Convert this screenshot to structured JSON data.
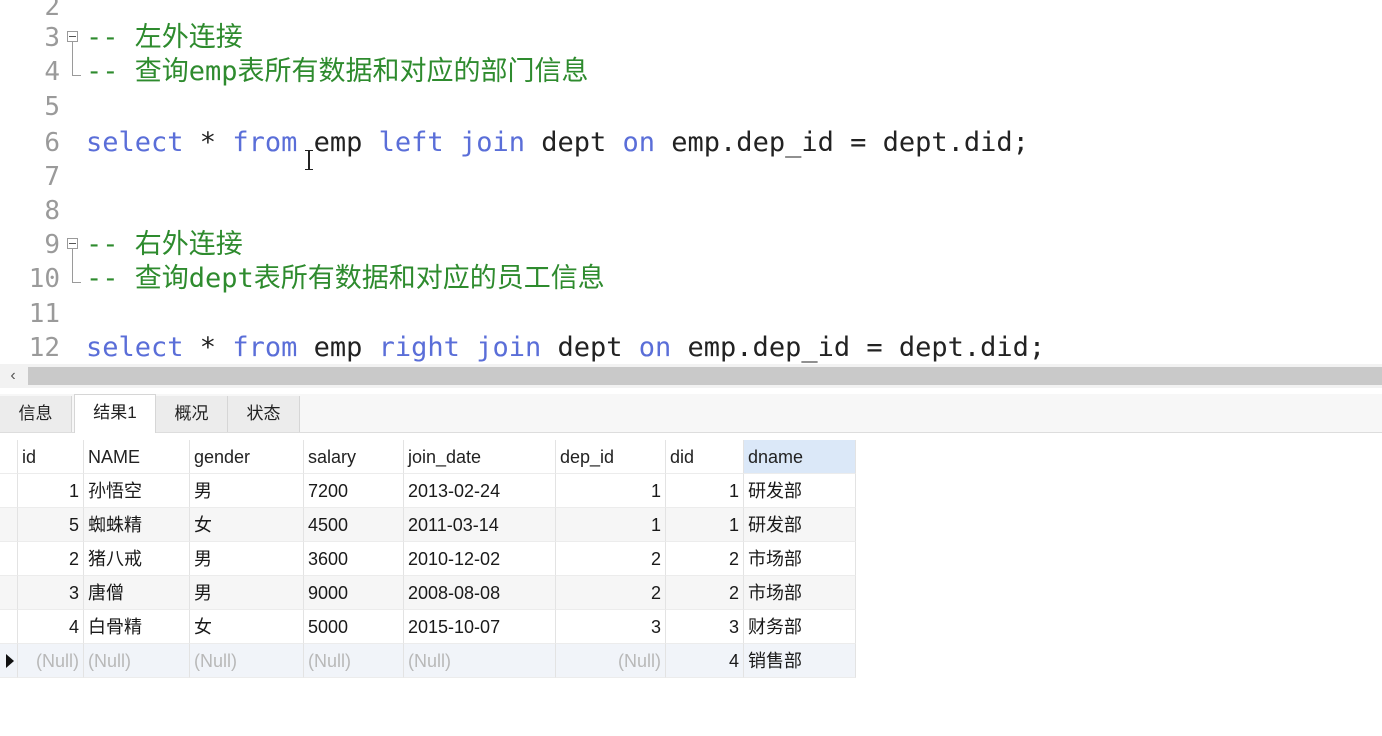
{
  "editor": {
    "lines": [
      {
        "num": "2",
        "segments": []
      },
      {
        "num": "3",
        "fold": "start",
        "segments": [
          {
            "t": "-- 左外连接",
            "c": "cmt"
          }
        ]
      },
      {
        "num": "4",
        "fold": "end",
        "segments": [
          {
            "t": "-- 查询emp表所有数据和对应的部门信息",
            "c": "cmt"
          }
        ]
      },
      {
        "num": "5",
        "segments": []
      },
      {
        "num": "6",
        "segments": [
          {
            "t": "select",
            "c": "kw"
          },
          {
            "t": " * ",
            "c": "pl"
          },
          {
            "t": "from",
            "c": "kw"
          },
          {
            "t": " emp ",
            "c": "pl"
          },
          {
            "t": "left",
            "c": "kw"
          },
          {
            "t": " ",
            "c": "pl"
          },
          {
            "t": "join",
            "c": "kw"
          },
          {
            "t": " dept ",
            "c": "pl"
          },
          {
            "t": "on",
            "c": "kw"
          },
          {
            "t": " emp.dep_id = dept.did;",
            "c": "pl"
          }
        ]
      },
      {
        "num": "7",
        "segments": []
      },
      {
        "num": "8",
        "segments": []
      },
      {
        "num": "9",
        "fold": "start",
        "segments": [
          {
            "t": "-- 右外连接",
            "c": "cmt"
          }
        ]
      },
      {
        "num": "10",
        "fold": "end",
        "segments": [
          {
            "t": "-- 查询dept表所有数据和对应的员工信息",
            "c": "cmt"
          }
        ]
      },
      {
        "num": "11",
        "segments": []
      },
      {
        "num": "12",
        "segments": [
          {
            "t": "select",
            "c": "kw"
          },
          {
            "t": " * ",
            "c": "pl"
          },
          {
            "t": "from",
            "c": "kw"
          },
          {
            "t": " emp ",
            "c": "pl"
          },
          {
            "t": "right",
            "c": "kw"
          },
          {
            "t": " ",
            "c": "pl"
          },
          {
            "t": "join",
            "c": "kw"
          },
          {
            "t": " dept ",
            "c": "pl"
          },
          {
            "t": "on",
            "c": "kw"
          },
          {
            "t": " emp.dep_id = dept.did;",
            "c": "pl"
          }
        ]
      }
    ]
  },
  "scrollbar": {
    "left_arrow": "‹"
  },
  "tabs": [
    {
      "label": "信息",
      "active": false
    },
    {
      "label": "结果1",
      "active": true
    },
    {
      "label": "概况",
      "active": false
    },
    {
      "label": "状态",
      "active": false
    }
  ],
  "grid": {
    "columns": [
      "id",
      "NAME",
      "gender",
      "salary",
      "join_date",
      "dep_id",
      "did",
      "dname"
    ],
    "rows": [
      [
        "1",
        "孙悟空",
        "男",
        "7200",
        "2013-02-24",
        "1",
        "1",
        "研发部"
      ],
      [
        "5",
        "蜘蛛精",
        "女",
        "4500",
        "2011-03-14",
        "1",
        "1",
        "研发部"
      ],
      [
        "2",
        "猪八戒",
        "男",
        "3600",
        "2010-12-02",
        "2",
        "2",
        "市场部"
      ],
      [
        "3",
        "唐僧",
        "男",
        "9000",
        "2008-08-08",
        "2",
        "2",
        "市场部"
      ],
      [
        "4",
        "白骨精",
        "女",
        "5000",
        "2015-10-07",
        "3",
        "3",
        "财务部"
      ],
      [
        "(Null)",
        "(Null)",
        "(Null)",
        "(Null)",
        "(Null)",
        "(Null)",
        "4",
        "销售部"
      ]
    ],
    "current_row": 5
  },
  "colors": {
    "keyword": "#5a6ed8",
    "comment": "#2e8b2e",
    "line_number": "#9a9a9a"
  }
}
